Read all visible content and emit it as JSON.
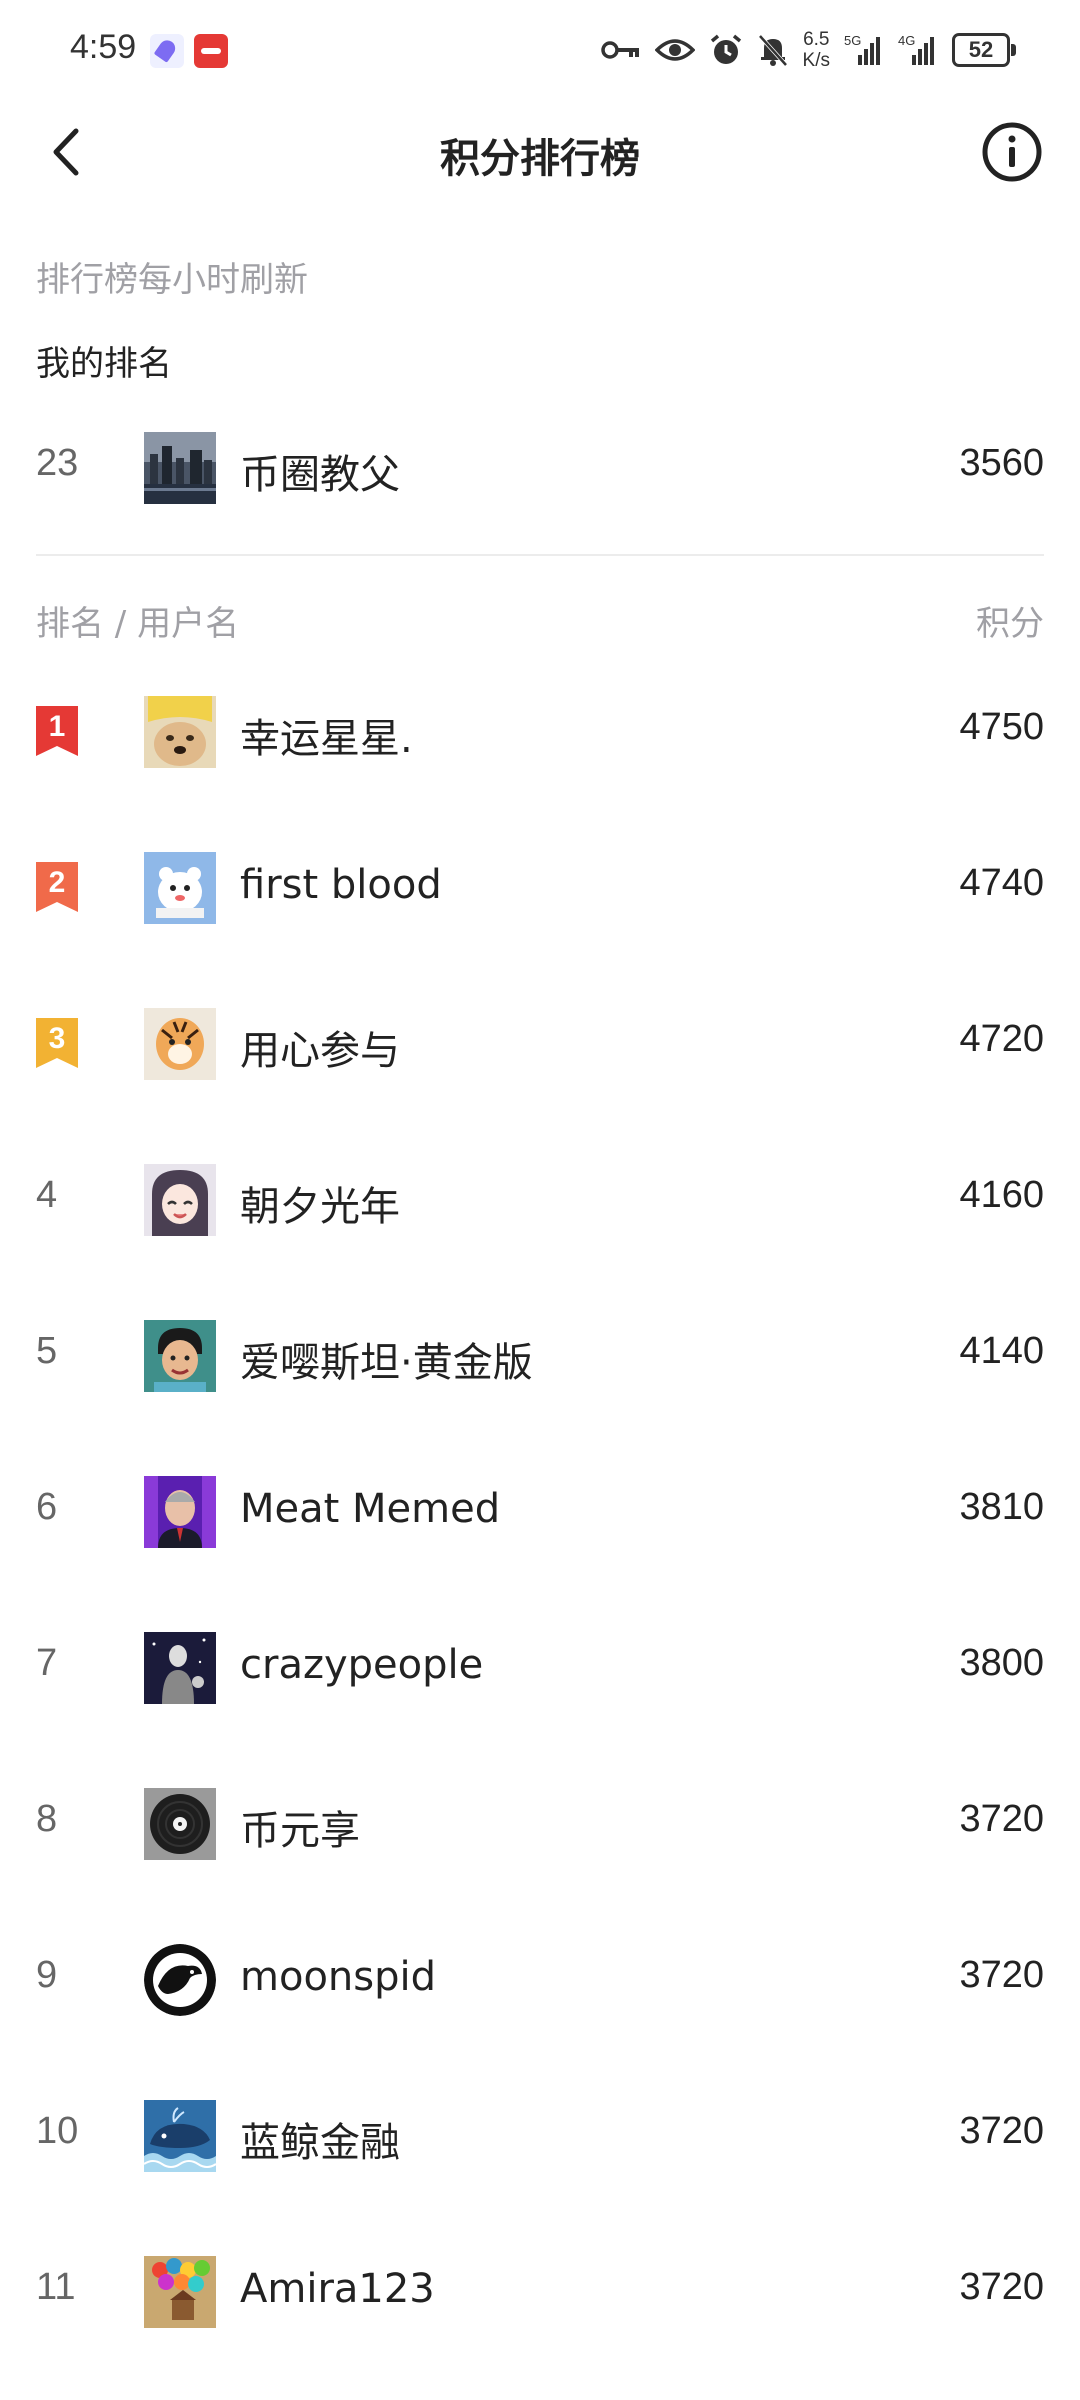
{
  "status_bar": {
    "time": "4:59",
    "net_speed_value": "6.5",
    "net_speed_unit": "K/s",
    "signal1_label": "5G",
    "signal2_label": "4G",
    "battery": "52"
  },
  "header": {
    "title": "积分排行榜"
  },
  "refresh_note": "排行榜每小时刷新",
  "my_rank": {
    "label": "我的排名",
    "rank": "23",
    "name": "币圈教父",
    "score": "3560"
  },
  "list_header": {
    "left": "排名 / 用户名",
    "right": "积分"
  },
  "colors": {
    "rank1": "#e53935",
    "rank2": "#f06a4a",
    "rank3": "#f2b233"
  },
  "rankings": [
    {
      "rank": "1",
      "name": "幸运星星.",
      "score": "4750"
    },
    {
      "rank": "2",
      "name": "first blood",
      "score": "4740"
    },
    {
      "rank": "3",
      "name": "用心参与",
      "score": "4720"
    },
    {
      "rank": "4",
      "name": "朝夕光年",
      "score": "4160"
    },
    {
      "rank": "5",
      "name": "爱嘤斯坦·黄金版",
      "score": "4140"
    },
    {
      "rank": "6",
      "name": "Meat Memed",
      "score": "3810"
    },
    {
      "rank": "7",
      "name": "crazypeople",
      "score": "3800"
    },
    {
      "rank": "8",
      "name": "币元享",
      "score": "3720"
    },
    {
      "rank": "9",
      "name": "moonspid",
      "score": "3720"
    },
    {
      "rank": "10",
      "name": "蓝鲸金融",
      "score": "3720"
    },
    {
      "rank": "11",
      "name": "Amira123",
      "score": "3720"
    }
  ]
}
